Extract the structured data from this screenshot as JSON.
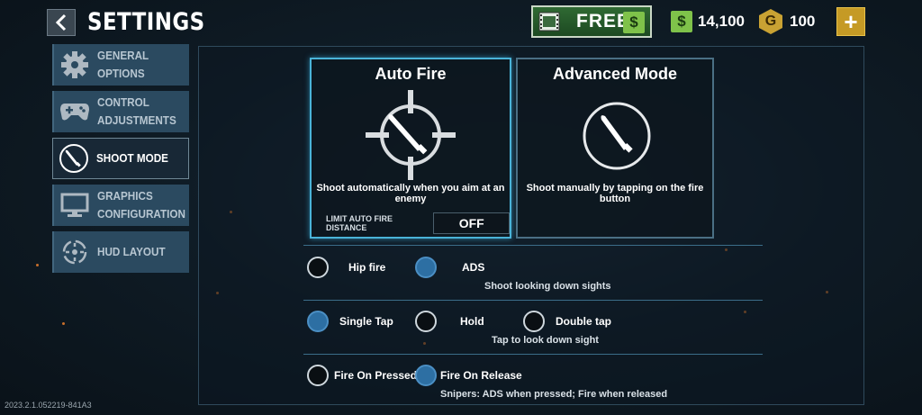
{
  "header": {
    "title": "SETTINGS",
    "free_label": "FREE",
    "cash_symbol": "$",
    "cash_amount": "14,100",
    "gold_symbol": "G",
    "gold_amount": "100",
    "plus_symbol": "+"
  },
  "sidebar": {
    "items": [
      {
        "label": "GENERAL OPTIONS",
        "icon": "gear-icon",
        "active": false
      },
      {
        "label": "CONTROL ADJUSTMENTS",
        "icon": "gamepad-icon",
        "active": false
      },
      {
        "label": "SHOOT MODE",
        "icon": "bullet-icon",
        "active": true
      },
      {
        "label": "GRAPHICS CONFIGURATION",
        "icon": "monitor-icon",
        "active": false
      },
      {
        "label": "HUD LAYOUT",
        "icon": "hud-icon",
        "active": false
      }
    ]
  },
  "modes": {
    "auto": {
      "title": "Auto Fire",
      "description": "Shoot automatically when you aim at an enemy",
      "limit_label": "LIMIT AUTO FIRE DISTANCE",
      "limit_value": "OFF",
      "selected": true
    },
    "advanced": {
      "title": "Advanced Mode",
      "description": "Shoot manually by tapping on the fire button",
      "selected": false
    }
  },
  "aim_options": {
    "items": [
      {
        "label": "Hip fire",
        "selected": false
      },
      {
        "label": "ADS",
        "selected": true
      }
    ],
    "hint": "Shoot looking down sights"
  },
  "tap_options": {
    "items": [
      {
        "label": "Single Tap",
        "selected": true
      },
      {
        "label": "Hold",
        "selected": false
      },
      {
        "label": "Double tap",
        "selected": false
      }
    ],
    "hint": "Tap to look down sight"
  },
  "fire_options": {
    "items": [
      {
        "label": "Fire On Pressed",
        "selected": false
      },
      {
        "label": "Fire On Release",
        "selected": true
      }
    ],
    "hint": "Snipers: ADS when pressed; Fire when released"
  },
  "footer": {
    "version": "2023.2.1.052219-841A3"
  },
  "colors": {
    "accent": "#4ab3d8",
    "radio_on": "#2d6fa3",
    "cash": "#7fc24a",
    "gold": "#c9a233"
  }
}
